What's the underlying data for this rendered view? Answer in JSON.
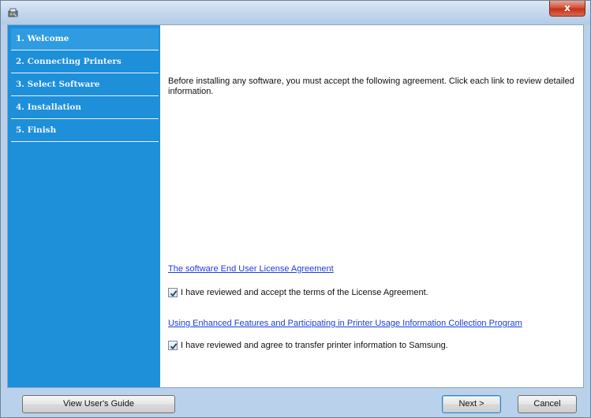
{
  "titlebar": {
    "close_label": "x"
  },
  "steps": [
    {
      "label": "1. Welcome",
      "active": true
    },
    {
      "label": "2. Connecting Printers",
      "active": false
    },
    {
      "label": "3. Select Software",
      "active": false
    },
    {
      "label": "4. Installation",
      "active": false
    },
    {
      "label": "5. Finish",
      "active": false
    }
  ],
  "content": {
    "intro": "Before installing any software, you must accept the following agreement. Click each link to review detailed information.",
    "eula_link": "The software End User License Agreement",
    "eula_check_label": "I have reviewed and accept the terms of the License Agreement.",
    "eula_checked": true,
    "usage_link": "Using Enhanced Features and Participating in Printer Usage Information Collection Program",
    "usage_check_label": "I have reviewed and agree to transfer printer information to Samsung.",
    "usage_checked": true
  },
  "buttons": {
    "guide": "View User's Guide",
    "next": "Next >",
    "cancel": "Cancel"
  },
  "colors": {
    "sidebar": "#1e8fd9",
    "link": "#1a3fd6",
    "frame": "#b9d1ea"
  }
}
